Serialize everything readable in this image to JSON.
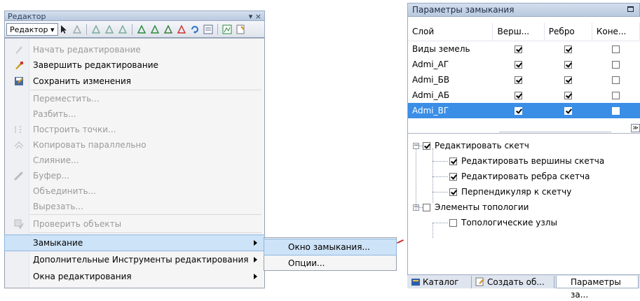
{
  "editor": {
    "title": "Редактор",
    "close_glyph": "▾ ×",
    "menu_button": "Редактор ▾",
    "toolbar_icons": [
      "edit-arrow-icon",
      "edit-annotation-icon",
      "straight-segment-icon",
      "arc-segment-icon",
      "trace-icon",
      "topology-edit-icon",
      "split-tool-icon",
      "move-icon",
      "delete-icon",
      "rotate-icon",
      "attributes-icon",
      "sketch-properties-icon",
      "create-features-icon"
    ]
  },
  "menu": {
    "items": [
      {
        "label": "Начать редактирование",
        "disabled": true,
        "icon": "pencil-icon"
      },
      {
        "label": "Завершить редактирование",
        "disabled": false,
        "icon": "stop-edit-icon"
      },
      {
        "label": "Сохранить изменения",
        "disabled": false,
        "icon": "save-edits-icon"
      },
      {
        "label": "Переместить...",
        "disabled": true,
        "icon": ""
      },
      {
        "label": "Разбить...",
        "disabled": true,
        "icon": ""
      },
      {
        "label": "Построить точки...",
        "disabled": true,
        "icon": "construct-points-icon"
      },
      {
        "label": "Копировать параллельно",
        "disabled": true,
        "icon": "copy-parallel-icon"
      },
      {
        "label": "Слияние...",
        "disabled": true,
        "icon": ""
      },
      {
        "label": "Буфер...",
        "disabled": true,
        "icon": "buffer-icon"
      },
      {
        "label": "Объединить...",
        "disabled": true,
        "icon": ""
      },
      {
        "label": "Вырезать...",
        "disabled": true,
        "icon": ""
      },
      {
        "label": "Проверить объекты",
        "disabled": true,
        "icon": "validate-features-icon"
      },
      {
        "label": "Замыкание",
        "disabled": false,
        "icon": "",
        "submenu": true,
        "highlighted": true
      },
      {
        "label": "Дополнительные Инструменты редактирования",
        "disabled": false,
        "icon": "",
        "submenu": true
      },
      {
        "label": "Окна редактирования",
        "disabled": false,
        "icon": "",
        "submenu": true
      }
    ]
  },
  "submenu": {
    "items": [
      {
        "label": "Окно замыкания...",
        "highlighted": true
      },
      {
        "label": "Опции..."
      }
    ]
  },
  "snapping": {
    "title": "Параметры замыкания",
    "columns": [
      "Слой",
      "Верш...",
      "Ребро",
      "Коне..."
    ],
    "rows": [
      {
        "layer": "Виды земель",
        "vertex": true,
        "edge": true,
        "end": false
      },
      {
        "layer": "Admi_АГ",
        "vertex": true,
        "edge": true,
        "end": false
      },
      {
        "layer": "Admi_БВ",
        "vertex": true,
        "edge": true,
        "end": false
      },
      {
        "layer": "Admi_АБ",
        "vertex": true,
        "edge": true,
        "end": false
      },
      {
        "layer": "Admi_ВГ",
        "vertex": true,
        "edge": true,
        "end": false,
        "selected": true
      }
    ],
    "tree": [
      {
        "label": "Редактировать скетч",
        "checked": true,
        "level": 0,
        "expander": "−"
      },
      {
        "label": "Редактировать вершины скетча",
        "checked": true,
        "level": 1
      },
      {
        "label": "Редактировать ребра скетча",
        "checked": true,
        "level": 1
      },
      {
        "label": "Перпендикуляр к скетчу",
        "checked": true,
        "level": 1
      },
      {
        "label": "Элементы топологии",
        "checked": false,
        "level": 0,
        "expander": "−"
      },
      {
        "label": "Топологические узлы",
        "checked": false,
        "level": 1
      }
    ],
    "collapse_glyph": "≫"
  },
  "tabs": [
    {
      "label": "Каталог",
      "icon": "catalog-icon"
    },
    {
      "label": "Создать об...",
      "icon": "create-features-icon"
    },
    {
      "label": "Параметры за...",
      "icon": "",
      "active": true
    }
  ],
  "colors": {
    "selection": "#3a8ee6",
    "menu_highlight": "#cde3f7",
    "title_bar": "#c6d4e6"
  }
}
